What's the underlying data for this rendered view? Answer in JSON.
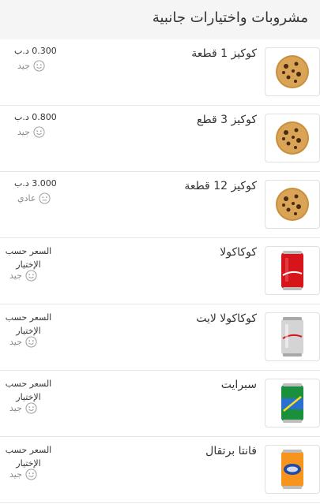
{
  "header": {
    "title": "مشروبات واختيارات جانبية"
  },
  "items": [
    {
      "name": "كوكيز 1 قطعة",
      "price": "0.300 د.ب",
      "rating": "جيد",
      "face": "smile-icon",
      "image": "cookie-icon"
    },
    {
      "name": "كوكيز 3 قطع",
      "price": "0.800 د.ب",
      "rating": "جيد",
      "face": "smile-icon",
      "image": "cookie-icon"
    },
    {
      "name": "كوكيز 12 قطعة",
      "price": "3.000 د.ب",
      "rating": "عادي",
      "face": "neutral-face-icon",
      "image": "cookie-icon"
    },
    {
      "name": "كوكاكولا",
      "price_line1": "السعر حسب",
      "price_line2": "الإختيار",
      "rating": "جيد",
      "face": "smile-icon",
      "image": "coca-cola-can-icon",
      "color": "#d7141a"
    },
    {
      "name": "كوكاكولا لايت",
      "price_line1": "السعر حسب",
      "price_line2": "الإختيار",
      "rating": "جيد",
      "face": "smile-icon",
      "image": "coca-cola-light-can-icon",
      "color": "#c8c8c8"
    },
    {
      "name": "سبرايت",
      "price_line1": "السعر حسب",
      "price_line2": "الإختيار",
      "rating": "جيد",
      "face": "smile-icon",
      "image": "sprite-can-icon",
      "color": "#1a8f3c"
    },
    {
      "name": "فانتا برتقال",
      "price_line1": "السعر حسب",
      "price_line2": "الإختيار",
      "rating": "جيد",
      "face": "smile-icon",
      "image": "fanta-orange-can-icon",
      "color": "#f7941d"
    }
  ]
}
